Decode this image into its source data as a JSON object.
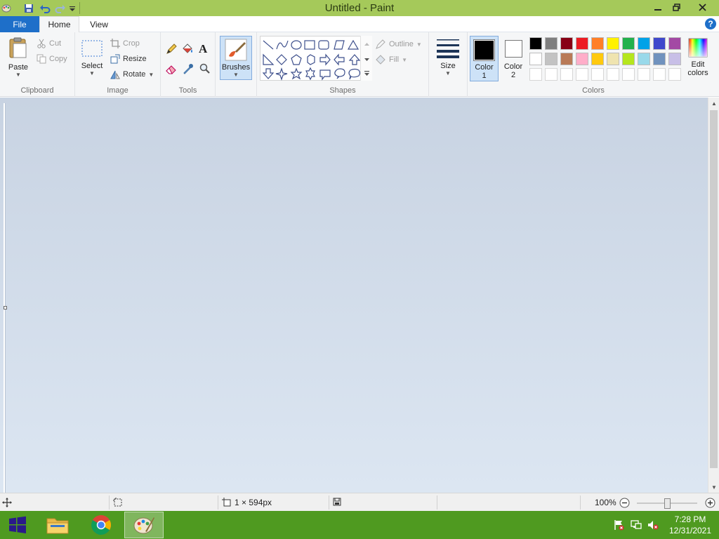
{
  "window": {
    "title": "Untitled - Paint"
  },
  "menu": {
    "file": "File",
    "home": "Home",
    "view": "View"
  },
  "ribbon": {
    "clipboard": {
      "label": "Clipboard",
      "paste": "Paste",
      "cut": "Cut",
      "copy": "Copy"
    },
    "image": {
      "label": "Image",
      "select": "Select",
      "crop": "Crop",
      "resize": "Resize",
      "rotate": "Rotate"
    },
    "tools": {
      "label": "Tools"
    },
    "brushes": {
      "label": "Brushes"
    },
    "shapes": {
      "label": "Shapes",
      "outline": "Outline",
      "fill": "Fill"
    },
    "size": {
      "label": "Size"
    },
    "colors": {
      "label": "Colors",
      "color1": "Color",
      "color1_num": "1",
      "color2": "Color",
      "color2_num": "2",
      "edit": "Edit",
      "edit2": "colors",
      "color1_value": "#000000",
      "color2_value": "#ffffff",
      "palette_row1": [
        "#000000",
        "#7f7f7f",
        "#880015",
        "#ed1c24",
        "#ff7f27",
        "#fff200",
        "#22b14c",
        "#00a2e8",
        "#3f48cc",
        "#a349a4"
      ],
      "palette_row2": [
        "#ffffff",
        "#c3c3c3",
        "#b97a57",
        "#ffaec9",
        "#ffc90e",
        "#efe4b0",
        "#b5e61d",
        "#99d9ea",
        "#7092be",
        "#c8bfe7"
      ],
      "palette_row3": [
        "#ffffff",
        "#ffffff",
        "#ffffff",
        "#ffffff",
        "#ffffff",
        "#ffffff",
        "#ffffff",
        "#ffffff",
        "#ffffff",
        "#ffffff"
      ]
    }
  },
  "status": {
    "dimensions": "1 × 594px",
    "zoom": "100%",
    "zoom_slider_percent": 50
  },
  "taskbar": {
    "time": "7:28 PM",
    "date": "12/31/2021"
  }
}
